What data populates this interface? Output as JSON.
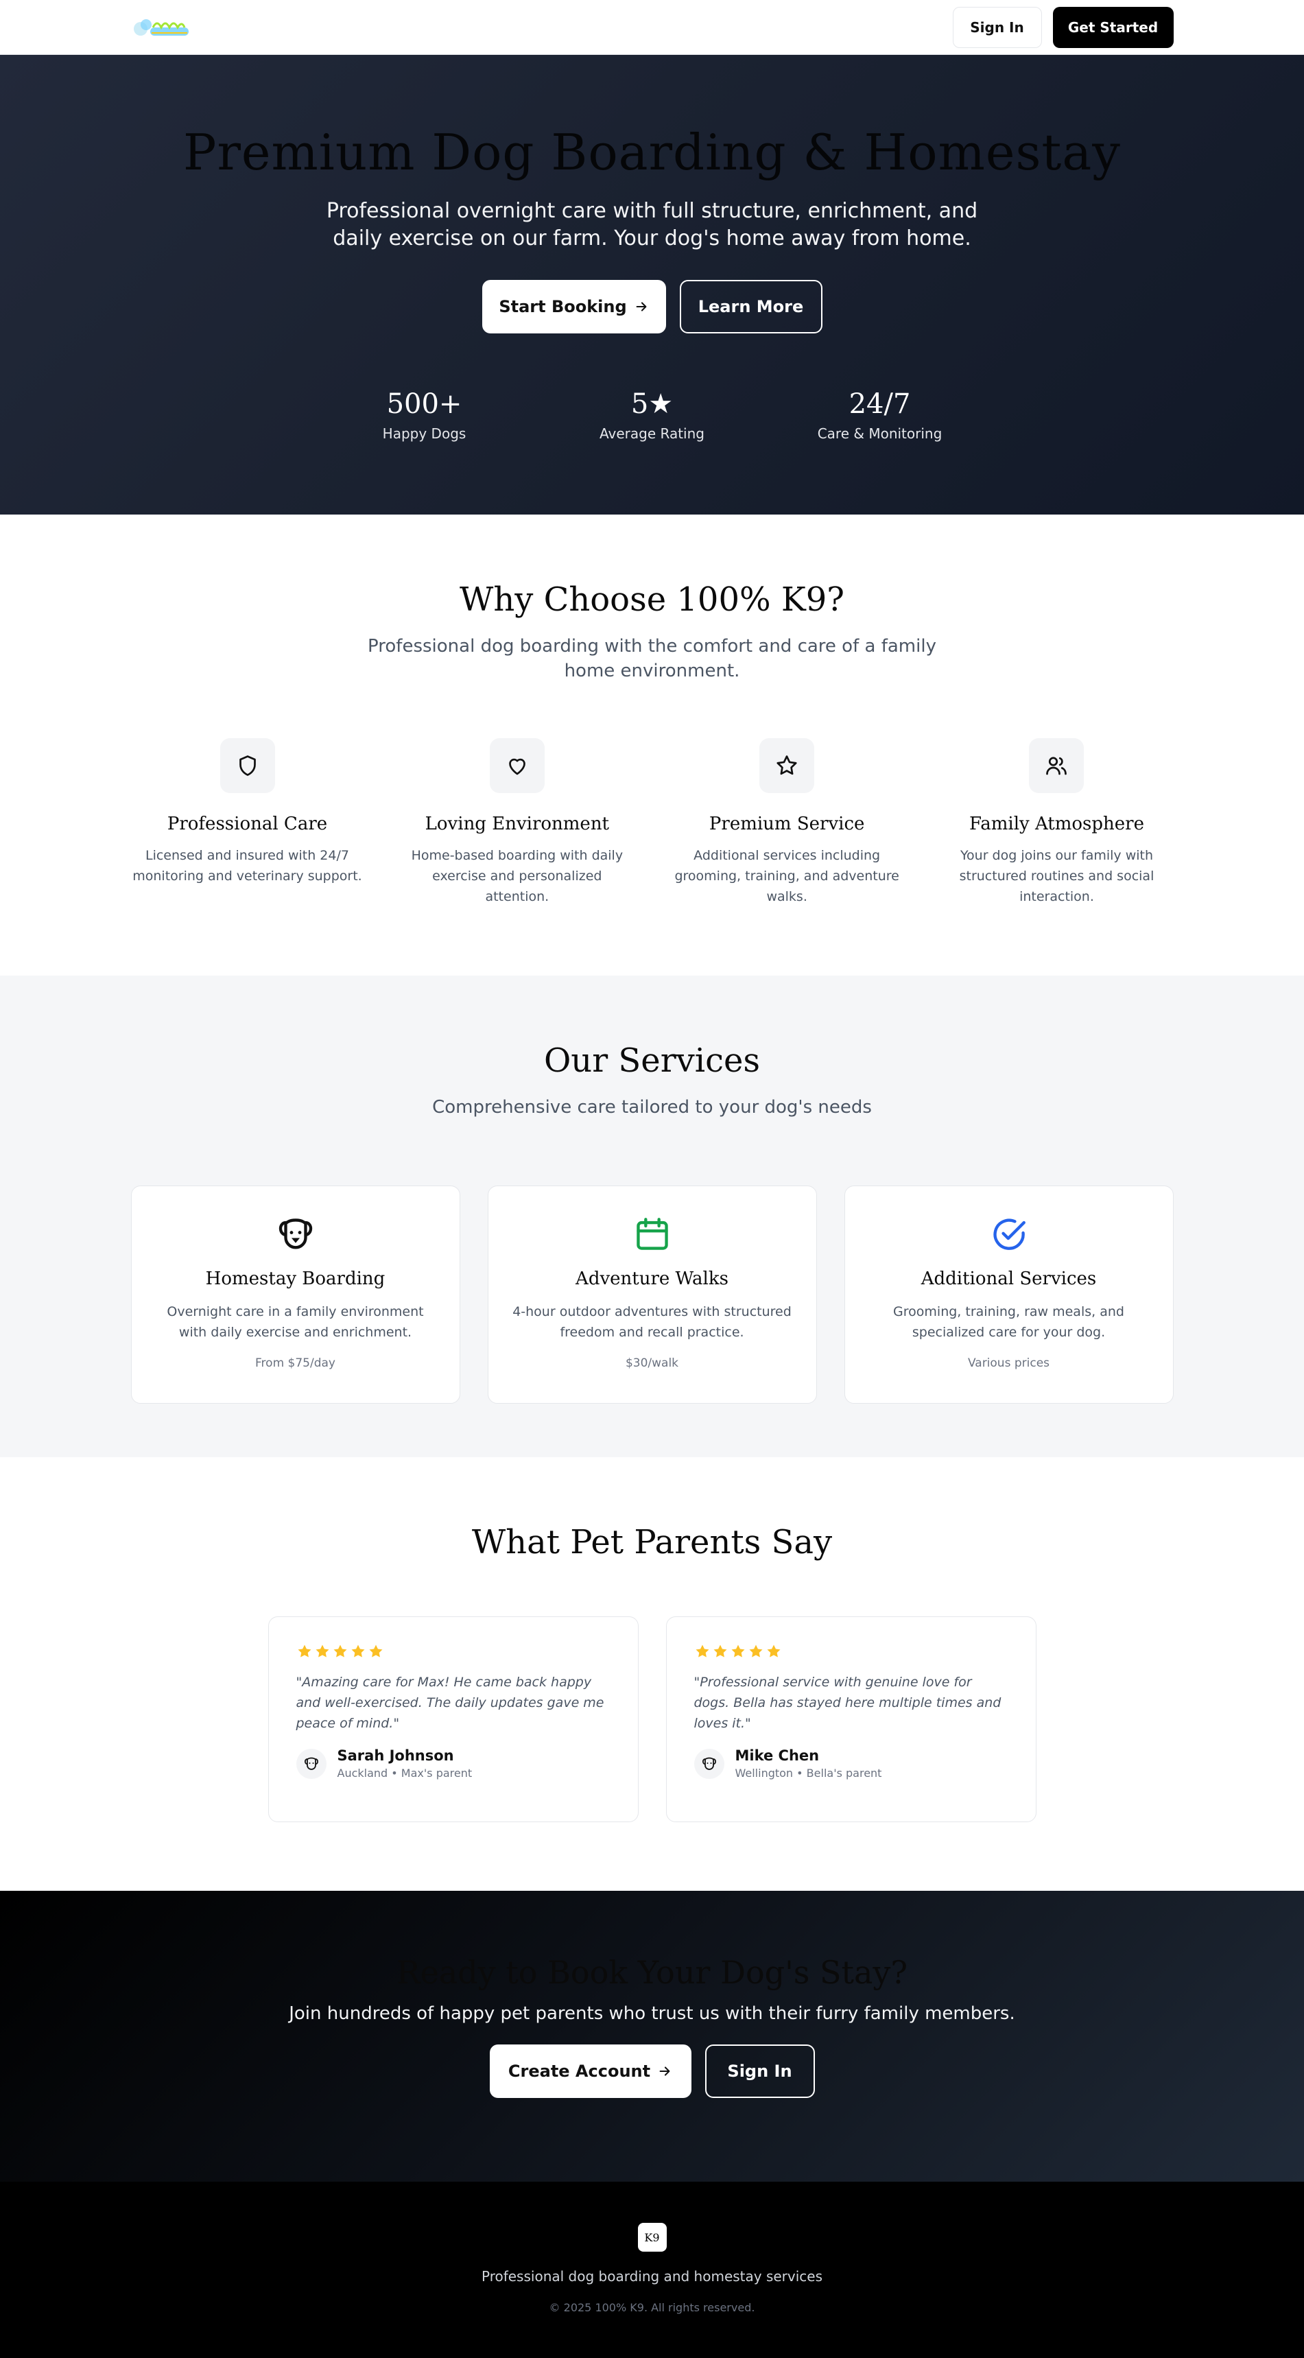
{
  "header": {
    "sign_in": "Sign In",
    "get_started": "Get Started"
  },
  "hero": {
    "title": "Premium Dog Boarding & Homestay",
    "subtitle": "Professional overnight care with full structure, enrichment, and daily exercise on our farm. Your dog's home away from home.",
    "start_booking": "Start Booking",
    "learn_more": "Learn More",
    "stats": [
      {
        "value": "500+",
        "label": "Happy Dogs"
      },
      {
        "value": "5★",
        "label": "Average Rating"
      },
      {
        "value": "24/7",
        "label": "Care & Monitoring"
      }
    ]
  },
  "why": {
    "title": "Why Choose 100% K9?",
    "subtitle": "Professional dog boarding with the comfort and care of a family home environment.",
    "features": [
      {
        "icon": "shield-icon",
        "title": "Professional Care",
        "text": "Licensed and insured with 24/7 monitoring and veterinary support."
      },
      {
        "icon": "heart-icon",
        "title": "Loving Environment",
        "text": "Home-based boarding with daily exercise and personalized attention."
      },
      {
        "icon": "star-icon",
        "title": "Premium Service",
        "text": "Additional services including grooming, training, and adventure walks."
      },
      {
        "icon": "users-icon",
        "title": "Family Atmosphere",
        "text": "Your dog joins our family with structured routines and social interaction."
      }
    ]
  },
  "services": {
    "title": "Our Services",
    "subtitle": "Comprehensive care tailored to your dog's needs",
    "items": [
      {
        "icon": "dog-icon",
        "title": "Homestay Boarding",
        "text": "Overnight care in a family environment with daily exercise and enrichment.",
        "price": "From $75/day"
      },
      {
        "icon": "calendar-icon",
        "title": "Adventure Walks",
        "text": "4-hour outdoor adventures with structured freedom and recall practice.",
        "price": "$30/walk"
      },
      {
        "icon": "check-circle-icon",
        "title": "Additional Services",
        "text": "Grooming, training, raw meals, and specialized care for your dog.",
        "price": "Various prices"
      }
    ]
  },
  "testimonials": {
    "title": "What Pet Parents Say",
    "items": [
      {
        "quote": "\"Amazing care for Max! He came back happy and well-exercised. The daily updates gave me peace of mind.\"",
        "name": "Sarah Johnson",
        "meta": "Auckland • Max's parent",
        "rating": 5
      },
      {
        "quote": "\"Professional service with genuine love for dogs. Bella has stayed here multiple times and loves it.\"",
        "name": "Mike Chen",
        "meta": "Wellington • Bella's parent",
        "rating": 5
      }
    ]
  },
  "cta": {
    "title": "Ready to Book Your Dog's Stay?",
    "subtitle": "Join hundreds of happy pet parents who trust us with their furry family members.",
    "create_account": "Create Account",
    "sign_in": "Sign In"
  },
  "footer": {
    "logo_text": "K9",
    "tagline": "Professional dog boarding and homestay services",
    "copyright": "© 2025 100% K9. All rights reserved."
  },
  "colors": {
    "star": "#fbbf24",
    "calendar_icon": "#16a34a",
    "check_icon": "#2563eb"
  }
}
